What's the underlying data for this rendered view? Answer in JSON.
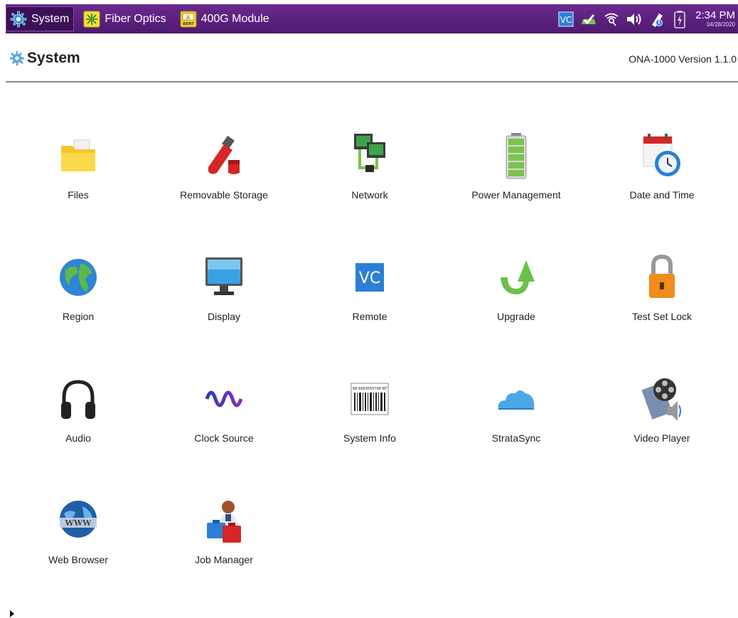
{
  "titlebar": {
    "tabs": [
      {
        "label": "System",
        "icon": "gear-icon",
        "active": true
      },
      {
        "label": "Fiber Optics",
        "icon": "fiber-optics-icon",
        "active": false
      },
      {
        "label": "400G Module",
        "icon": "bert-module-icon",
        "active": false
      }
    ],
    "status_icons": [
      "vnc-icon",
      "connected-check-icon",
      "wifi-icon",
      "volume-icon",
      "usb-icon",
      "battery-icon"
    ],
    "vnc_text": "VC",
    "bert_top": "JL",
    "bert_bottom": "BERT",
    "time": "2:34 PM",
    "date": "04/28/2020"
  },
  "header": {
    "title": "System",
    "version": "ONA-1000 Version 1.1.0"
  },
  "apps": [
    {
      "label": "Files",
      "icon": "folder-icon"
    },
    {
      "label": "Removable Storage",
      "icon": "usb-drive-icon"
    },
    {
      "label": "Network",
      "icon": "network-icon"
    },
    {
      "label": "Power Management",
      "icon": "battery-icon"
    },
    {
      "label": "Date and Time",
      "icon": "calendar-clock-icon"
    },
    {
      "label": "Region",
      "icon": "globe-icon"
    },
    {
      "label": "Display",
      "icon": "monitor-icon"
    },
    {
      "label": "Remote",
      "icon": "vnc-icon"
    },
    {
      "label": "Upgrade",
      "icon": "upgrade-arrow-icon"
    },
    {
      "label": "Test Set Lock",
      "icon": "padlock-icon"
    },
    {
      "label": "Audio",
      "icon": "headphones-icon"
    },
    {
      "label": "Clock Source",
      "icon": "waveform-icon"
    },
    {
      "label": "System Info",
      "icon": "barcode-icon"
    },
    {
      "label": "StrataSync",
      "icon": "cloud-icon"
    },
    {
      "label": "Video Player",
      "icon": "film-reel-icon"
    },
    {
      "label": "Web Browser",
      "icon": "www-globe-icon"
    },
    {
      "label": "Job Manager",
      "icon": "job-manager-icon"
    }
  ],
  "barcode_text": "SN 6663555768 NT",
  "remote_text": "VC",
  "www_text": "WWW",
  "colors": {
    "titlebar": "#5a1f7e",
    "accent_green": "#6cc04a",
    "folder": "#f7c52b",
    "lock": "#f28c1c",
    "cloud": "#4aa8e6"
  }
}
